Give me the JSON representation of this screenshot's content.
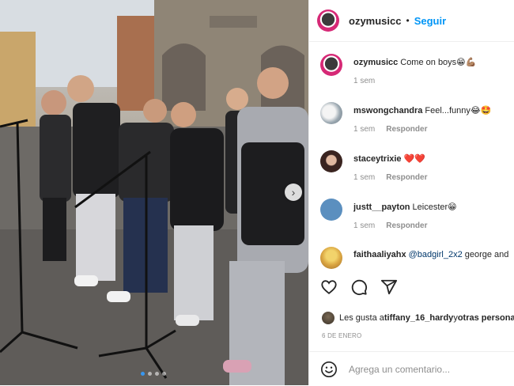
{
  "post": {
    "username": "ozymusicc",
    "separator": "•",
    "follow_label": "Seguir"
  },
  "comments": [
    {
      "user": "ozymusicc",
      "text": "Come on boys😁💪🏽",
      "time": "1 sem",
      "reply": ""
    },
    {
      "user": "mswongchandra",
      "text": "Feel...funny😂🤩",
      "time": "1 sem",
      "reply": "Responder"
    },
    {
      "user": "staceytrixie",
      "text": "❤️❤️",
      "time": "1 sem",
      "reply": "Responder"
    },
    {
      "user": "justt__payton",
      "text": "Leicester😁",
      "time": "1 sem",
      "reply": "Responder"
    },
    {
      "user": "faithaaliyahx",
      "mention": "@badgirl_2x2",
      "text": " george and",
      "time": "",
      "reply": ""
    }
  ],
  "likes": {
    "prefix": "Les gusta a ",
    "user": "tiffany_16_hardy",
    "middle": " y ",
    "suffix": "otras personas"
  },
  "date": "6 DE ENERO",
  "composer": {
    "placeholder": "Agrega un comentario..."
  },
  "carousel": {
    "next_icon": "›",
    "slides": 4,
    "active": 1
  },
  "colors": {
    "accent": "#0095f6",
    "muted": "#8e8e8e",
    "heart": "#ed4956"
  },
  "icons": [
    "heart-icon",
    "comment-icon",
    "share-icon",
    "emoji-icon",
    "chevron-right-icon"
  ]
}
